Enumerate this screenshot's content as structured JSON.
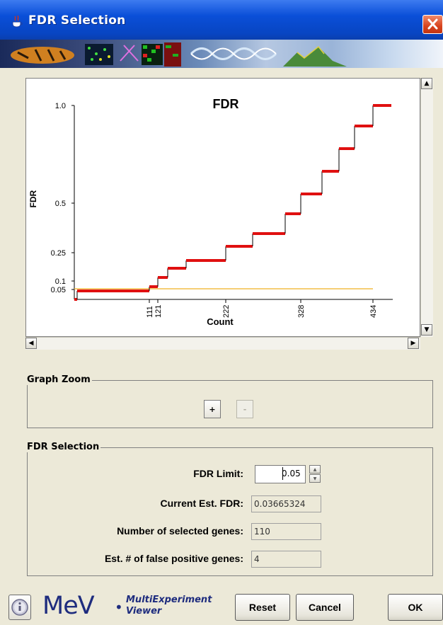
{
  "window": {
    "title": "FDR Selection"
  },
  "chart_data": {
    "type": "line",
    "title": "FDR",
    "xlabel": "Count",
    "ylabel": "FDR",
    "x_ticks": [
      111,
      121,
      222,
      328,
      434
    ],
    "y_ticks": [
      "0.05",
      "0.1",
      "0.25",
      "0.5",
      "1.0"
    ],
    "xlim": [
      0,
      450
    ],
    "ylim": [
      0,
      1.0
    ],
    "threshold_line": {
      "value": 0.05,
      "color": "#f0b020"
    },
    "step_color": "#e01010",
    "steps": [
      {
        "x0": 0,
        "x1": 3,
        "y": 0.0
      },
      {
        "x0": 3,
        "x1": 110,
        "y": 0.0366
      },
      {
        "x0": 110,
        "x1": 120,
        "y": 0.05
      },
      {
        "x0": 120,
        "x1": 137,
        "y": 0.1
      },
      {
        "x0": 137,
        "x1": 164,
        "y": 0.125
      },
      {
        "x0": 164,
        "x1": 222,
        "y": 0.15
      },
      {
        "x0": 222,
        "x1": 262,
        "y": 0.25
      },
      {
        "x0": 262,
        "x1": 308,
        "y": 0.3
      },
      {
        "x0": 308,
        "x1": 330,
        "y": 0.4
      },
      {
        "x0": 330,
        "x1": 363,
        "y": 0.52
      },
      {
        "x0": 363,
        "x1": 397,
        "y": 0.62
      },
      {
        "x0": 397,
        "x1": 424,
        "y": 0.72
      },
      {
        "x0": 424,
        "x1": 452,
        "y": 0.83
      },
      {
        "x0": 452,
        "x1": 480,
        "y": 1.0
      }
    ]
  },
  "graph_zoom": {
    "label": "Graph Zoom",
    "zoom_in": "+",
    "zoom_out": "-"
  },
  "fdr_selection": {
    "label": "FDR Selection",
    "fdr_limit_label": "FDR Limit:",
    "fdr_limit_value": "0.05",
    "current_est_label": "Current Est. FDR:",
    "current_est_value": "0.03665324",
    "num_selected_label": "Number of selected genes:",
    "num_selected_value": "110",
    "false_positive_label": "Est. # of false positive genes:",
    "false_positive_value": "4"
  },
  "footer": {
    "logo_main": "MeV",
    "logo_sub1": "MultiExperiment",
    "logo_sub2": "Viewer",
    "reset_label": "Reset",
    "cancel_label": "Cancel",
    "ok_label": "OK"
  }
}
